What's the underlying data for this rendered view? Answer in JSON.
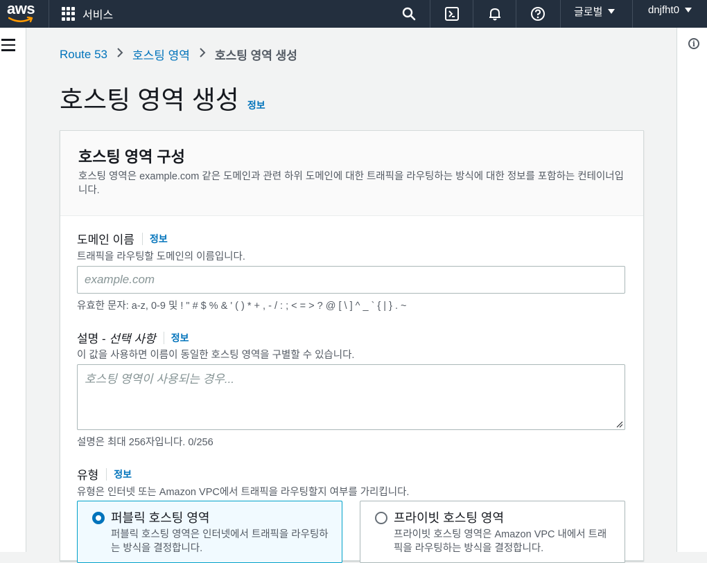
{
  "topbar": {
    "logo_text": "aws",
    "services_label": "서비스",
    "region_label": "글로벌",
    "user_label": "dnjfht0"
  },
  "breadcrumb": {
    "items": [
      "Route 53",
      "호스팅 영역",
      "호스팅 영역 생성"
    ]
  },
  "page": {
    "title": "호스팅 영역 생성",
    "info": "정보"
  },
  "panel": {
    "title": "호스팅 영역 구성",
    "description": "호스팅 영역은 example.com 같은 도메인과 관련 하위 도메인에 대한 트래픽을 라우팅하는 방식에 대한 정보를 포함하는 컨테이너입니다."
  },
  "domain_field": {
    "label": "도메인 이름",
    "info": "정보",
    "description": "트래픽을 라우팅할 도메인의 이름입니다.",
    "placeholder": "example.com",
    "value": "",
    "constraint": "유효한 문자: a-z, 0-9 및 ! \" # $ % & ' ( ) * + , - / : ; < = > ? @ [ \\ ] ^ _ ` { | } . ~"
  },
  "description_field": {
    "label": "설명 - ",
    "label_optional": "선택 사항",
    "info": "정보",
    "description": "이 값을 사용하면 이름이 동일한 호스팅 영역을 구별할 수 있습니다.",
    "placeholder": "호스팅 영역이 사용되는 경우...",
    "value": "",
    "constraint": "설명은 최대 256자입니다. 0/256"
  },
  "type_field": {
    "label": "유형",
    "info": "정보",
    "description": "유형은 인터넷 또는 Amazon VPC에서 트래픽을 라우팅할지 여부를 가리킵니다.",
    "options": [
      {
        "title": "퍼블릭 호스팅 영역",
        "description": "퍼블릭 호스팅 영역은 인터넷에서 트래픽을 라우팅하는 방식을 결정합니다.",
        "selected": true
      },
      {
        "title": "프라이빗 호스팅 영역",
        "description": "프라이빗 호스팅 영역은 Amazon VPC 내에서 트래픽을 라우팅하는 방식을 결정합니다.",
        "selected": false
      }
    ]
  },
  "colors": {
    "topbar_bg": "#232f3e",
    "link": "#0073bb",
    "selected_tile_border": "#00a1c9",
    "selected_tile_bg": "#f1faff"
  }
}
